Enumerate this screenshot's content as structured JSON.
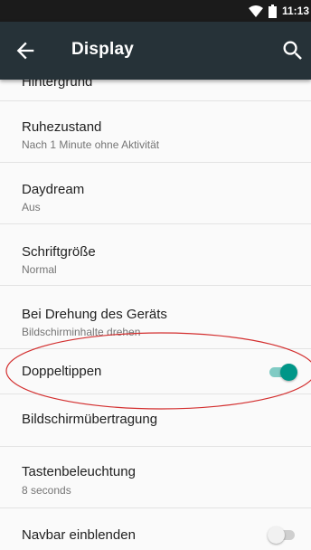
{
  "status_bar": {
    "time": "11:13",
    "icons": [
      "wifi-icon",
      "battery-icon"
    ]
  },
  "app_bar": {
    "title": "Display",
    "back_icon": "arrow-back-icon",
    "search_icon": "search-icon"
  },
  "settings": [
    {
      "title": "Hintergrund",
      "subtitle": ""
    },
    {
      "title": "Ruhezustand",
      "subtitle": "Nach 1 Minute ohne Aktivität"
    },
    {
      "title": "Daydream",
      "subtitle": "Aus"
    },
    {
      "title": "Schriftgröße",
      "subtitle": "Normal"
    },
    {
      "title": "Bei Drehung des Geräts",
      "subtitle": "Bildschirminhalte drehen"
    },
    {
      "title": "Doppeltippen",
      "subtitle": "",
      "toggle": "on"
    },
    {
      "title": "Bildschirmübertragung",
      "subtitle": ""
    },
    {
      "title": "Tastenbeleuchtung",
      "subtitle": "8 seconds"
    },
    {
      "title": "Navbar einblenden",
      "subtitle": "",
      "toggle": "off"
    }
  ],
  "colors": {
    "app_bar": "#263238",
    "status_bar": "#1b1b1b",
    "toggle_on": "#009688",
    "annotation": "#d32f2f"
  }
}
